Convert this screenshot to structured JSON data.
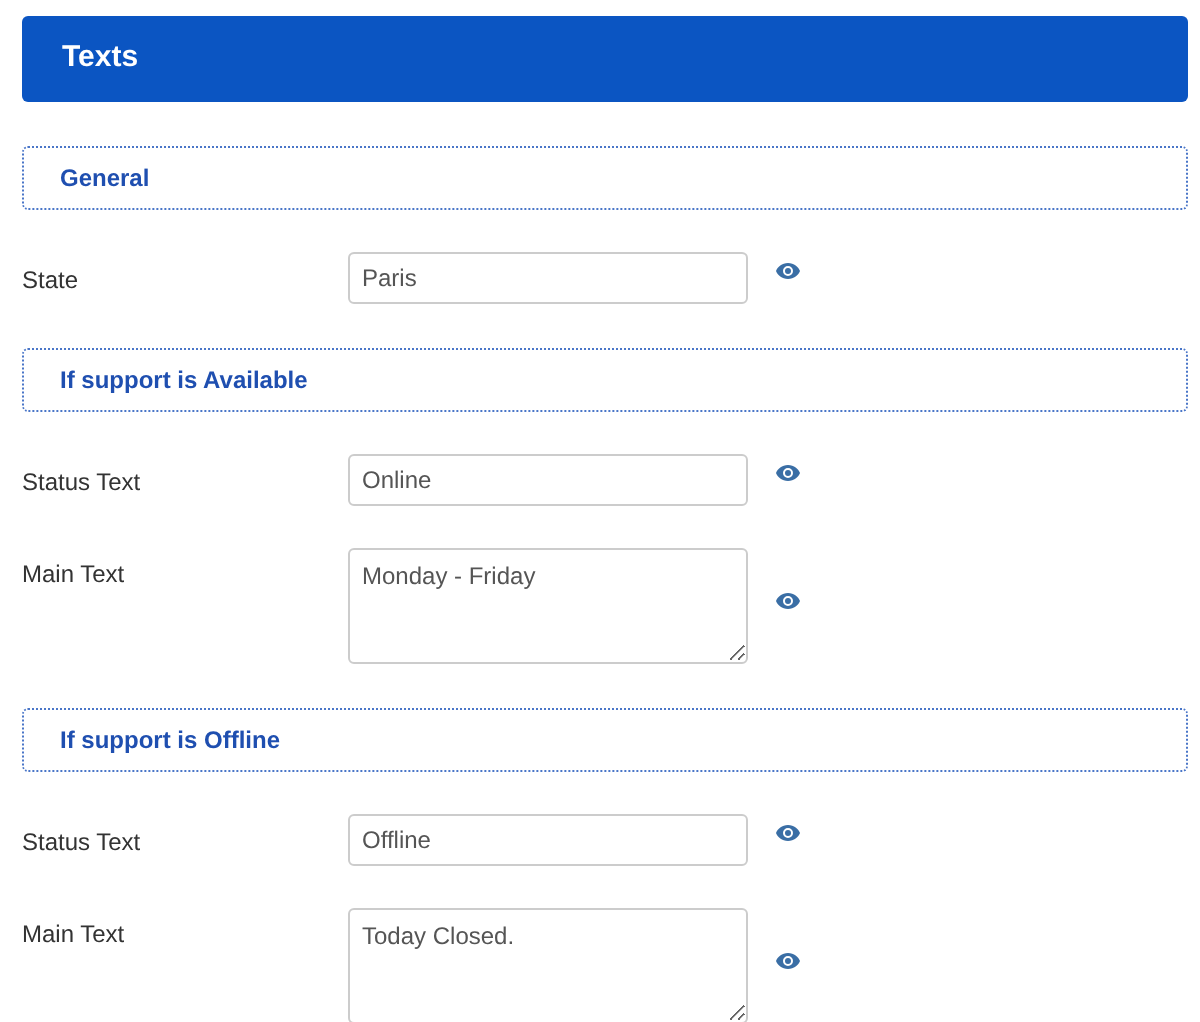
{
  "header": {
    "title": "Texts"
  },
  "sections": [
    {
      "title": "General",
      "fields": [
        {
          "label": "State",
          "kind": "input",
          "value": "Paris"
        }
      ]
    },
    {
      "title": "If support is Available",
      "fields": [
        {
          "label": "Status Text",
          "kind": "input",
          "value": "Online"
        },
        {
          "label": "Main Text",
          "kind": "textarea",
          "value": "Monday - Friday"
        }
      ]
    },
    {
      "title": "If support is Offline",
      "fields": [
        {
          "label": "Status Text",
          "kind": "input",
          "value": "Offline"
        },
        {
          "label": "Main Text",
          "kind": "textarea",
          "value": "Today Closed."
        }
      ]
    }
  ]
}
